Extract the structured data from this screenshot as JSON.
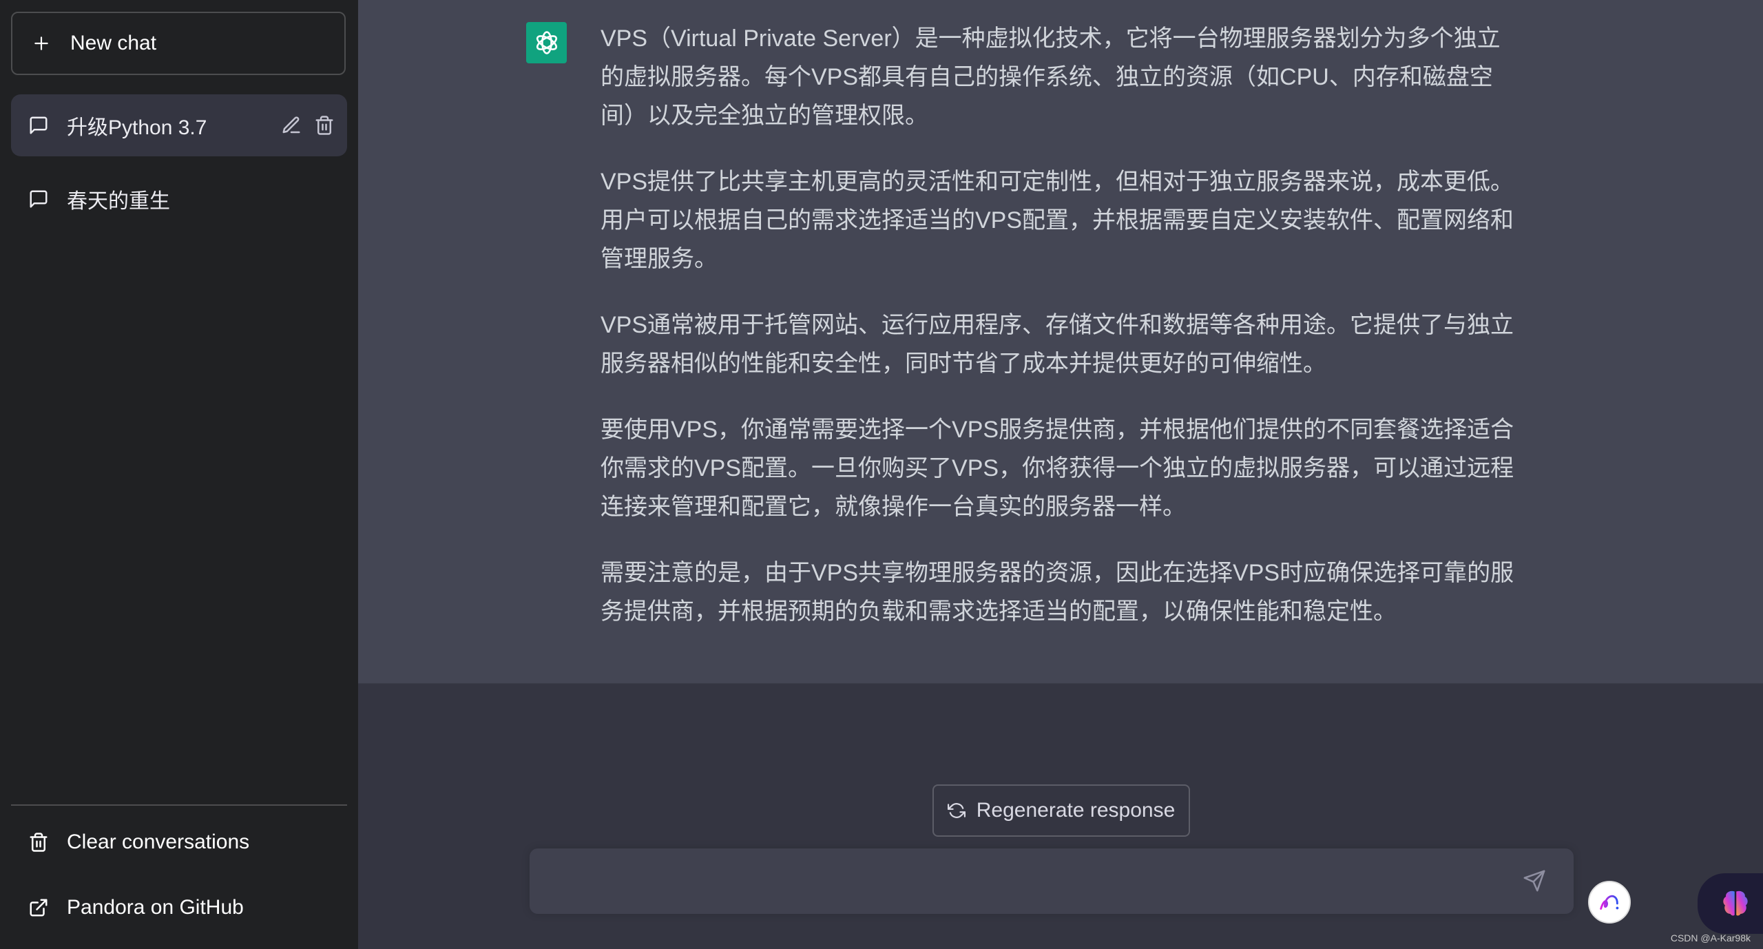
{
  "sidebar": {
    "new_chat_label": "New chat",
    "conversations": [
      {
        "title": "升级Python 3.7",
        "active": true
      },
      {
        "title": "春天的重生",
        "active": false
      }
    ],
    "footer": {
      "clear_label": "Clear conversations",
      "github_label": "Pandora on GitHub"
    }
  },
  "message": {
    "role": "assistant",
    "paragraphs": [
      "VPS（Virtual Private Server）是一种虚拟化技术，它将一台物理服务器划分为多个独立的虚拟服务器。每个VPS都具有自己的操作系统、独立的资源（如CPU、内存和磁盘空间）以及完全独立的管理权限。",
      "VPS提供了比共享主机更高的灵活性和可定制性，但相对于独立服务器来说，成本更低。用户可以根据自己的需求选择适当的VPS配置，并根据需要自定义安装软件、配置网络和管理服务。",
      "VPS通常被用于托管网站、运行应用程序、存储文件和数据等各种用途。它提供了与独立服务器相似的性能和安全性，同时节省了成本并提供更好的可伸缩性。",
      "要使用VPS，你通常需要选择一个VPS服务提供商，并根据他们提供的不同套餐选择适合你需求的VPS配置。一旦你购买了VPS，你将获得一个独立的虚拟服务器，可以通过远程连接来管理和配置它，就像操作一台真实的服务器一样。",
      "需要注意的是，由于VPS共享物理服务器的资源，因此在选择VPS时应确保选择可靠的服务提供商，并根据预期的负载和需求选择适当的配置，以确保性能和稳定性。"
    ]
  },
  "composer": {
    "regenerate_label": "Regenerate response",
    "input_value": "",
    "input_placeholder": ""
  },
  "watermark": "CSDN @A-Kar98k",
  "colors": {
    "sidebar_bg": "#202123",
    "main_bg": "#343541",
    "message_bg": "#444654",
    "avatar_bg": "#10a37f",
    "input_bg": "#40414f"
  }
}
